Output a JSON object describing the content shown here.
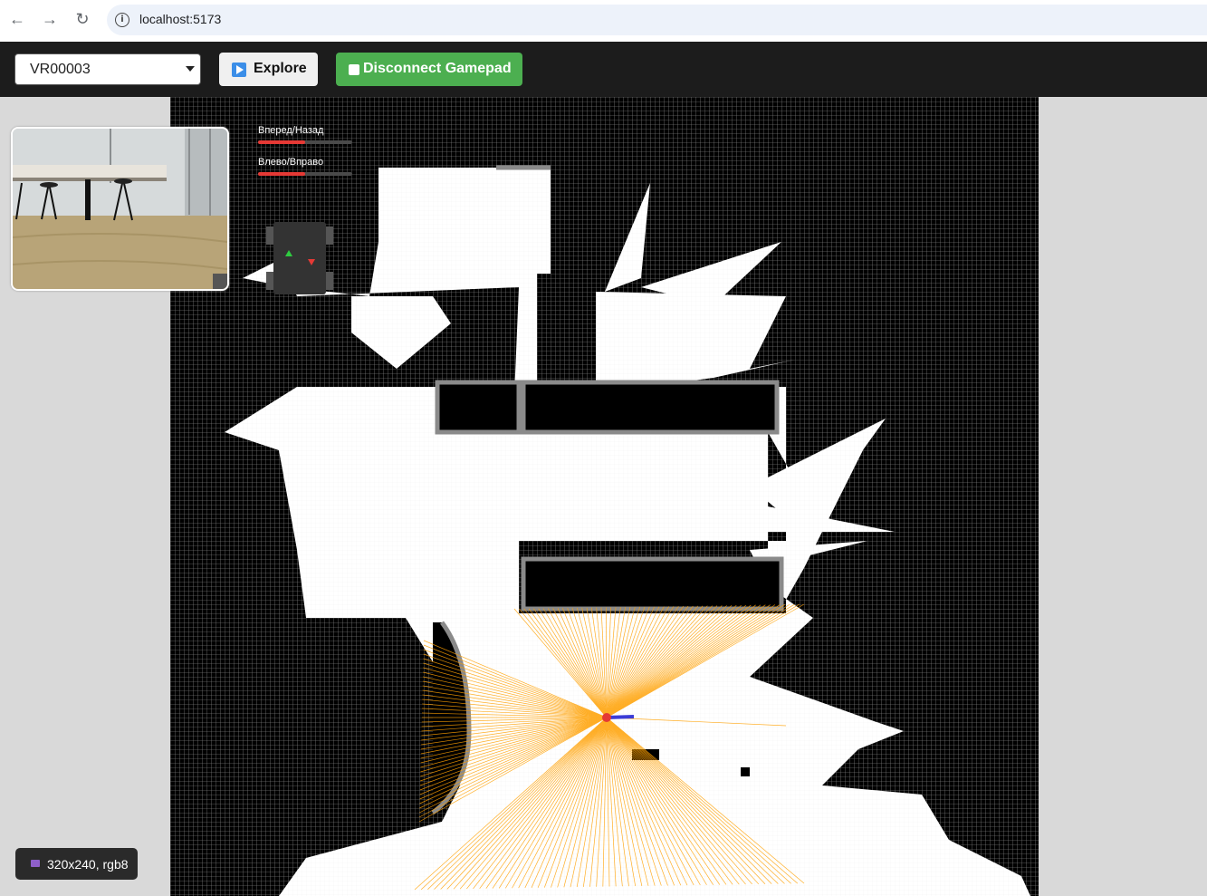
{
  "browser": {
    "url": "localhost:5173",
    "back_icon": "arrow-left",
    "forward_icon": "arrow-right",
    "reload_icon": "reload",
    "info_icon": "info"
  },
  "toolbar": {
    "robot_select": {
      "selected": "VR00003"
    },
    "explore_button": {
      "label": "Explore",
      "icon": "play-icon"
    },
    "gamepad_button": {
      "label": "Disconnect Gamepad",
      "icon": "stop-icon",
      "color": "#4caf50"
    }
  },
  "joystick": {
    "forward_back": {
      "label": "Вперед/Назад",
      "fill": 0.5
    },
    "left_right": {
      "label": "Влево/Вправо",
      "fill": 0.5
    },
    "bar_color": "#e53935"
  },
  "camera_status": {
    "text": "320x240, rgb8",
    "icon": "camera-icon"
  },
  "map": {
    "free_color": "#ffffff",
    "wall_color": "#8a8a8a",
    "unknown_color": "#000000",
    "laser_color": "#ffa000",
    "robot_color": "#e53935",
    "heading_color": "#3b3bd6"
  }
}
